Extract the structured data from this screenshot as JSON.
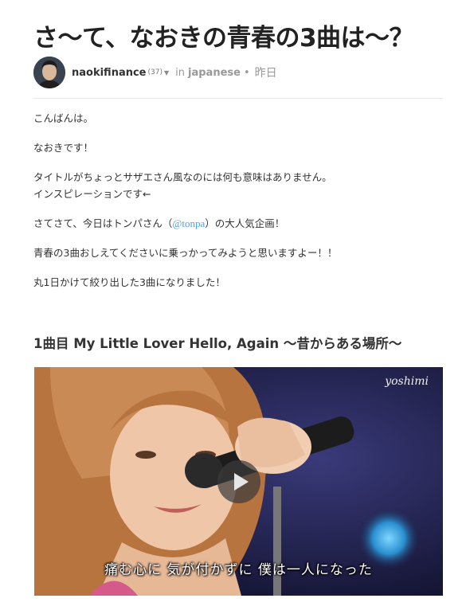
{
  "post": {
    "title": "さ〜て、なおきの青春の3曲は〜？",
    "author": "naokifinance",
    "reputation": "(37)",
    "in_label": "in",
    "category": "japanese",
    "separator": "•",
    "date": "昨日"
  },
  "body": {
    "p1": "こんばんは。",
    "p2": "なおきです！",
    "p3_line1": "タイトルがちょっとサザエさん風なのには何も意味はありません。",
    "p3_line2": "インスピレーションです←",
    "p4_before": "さてさて、今日はトンパさん（",
    "p4_mention": "@tonpa",
    "p4_after": "）の大人気企画！",
    "p5": "青春の3曲おしえてくださいに乗っかってみようと思いますよー！！",
    "p6": "丸1日かけて絞り出した3曲になりました！"
  },
  "section": {
    "heading": "1曲目 My Little Lover Hello, Again 〜昔からある場所〜"
  },
  "video": {
    "watermark": "yoshimi",
    "subtitle": "痛む心に 気が付かずに 僕は一人になった",
    "play_icon": "play-icon"
  },
  "colors": {
    "mention": "#4ba2f2",
    "text": "#333333",
    "muted": "#999999"
  }
}
